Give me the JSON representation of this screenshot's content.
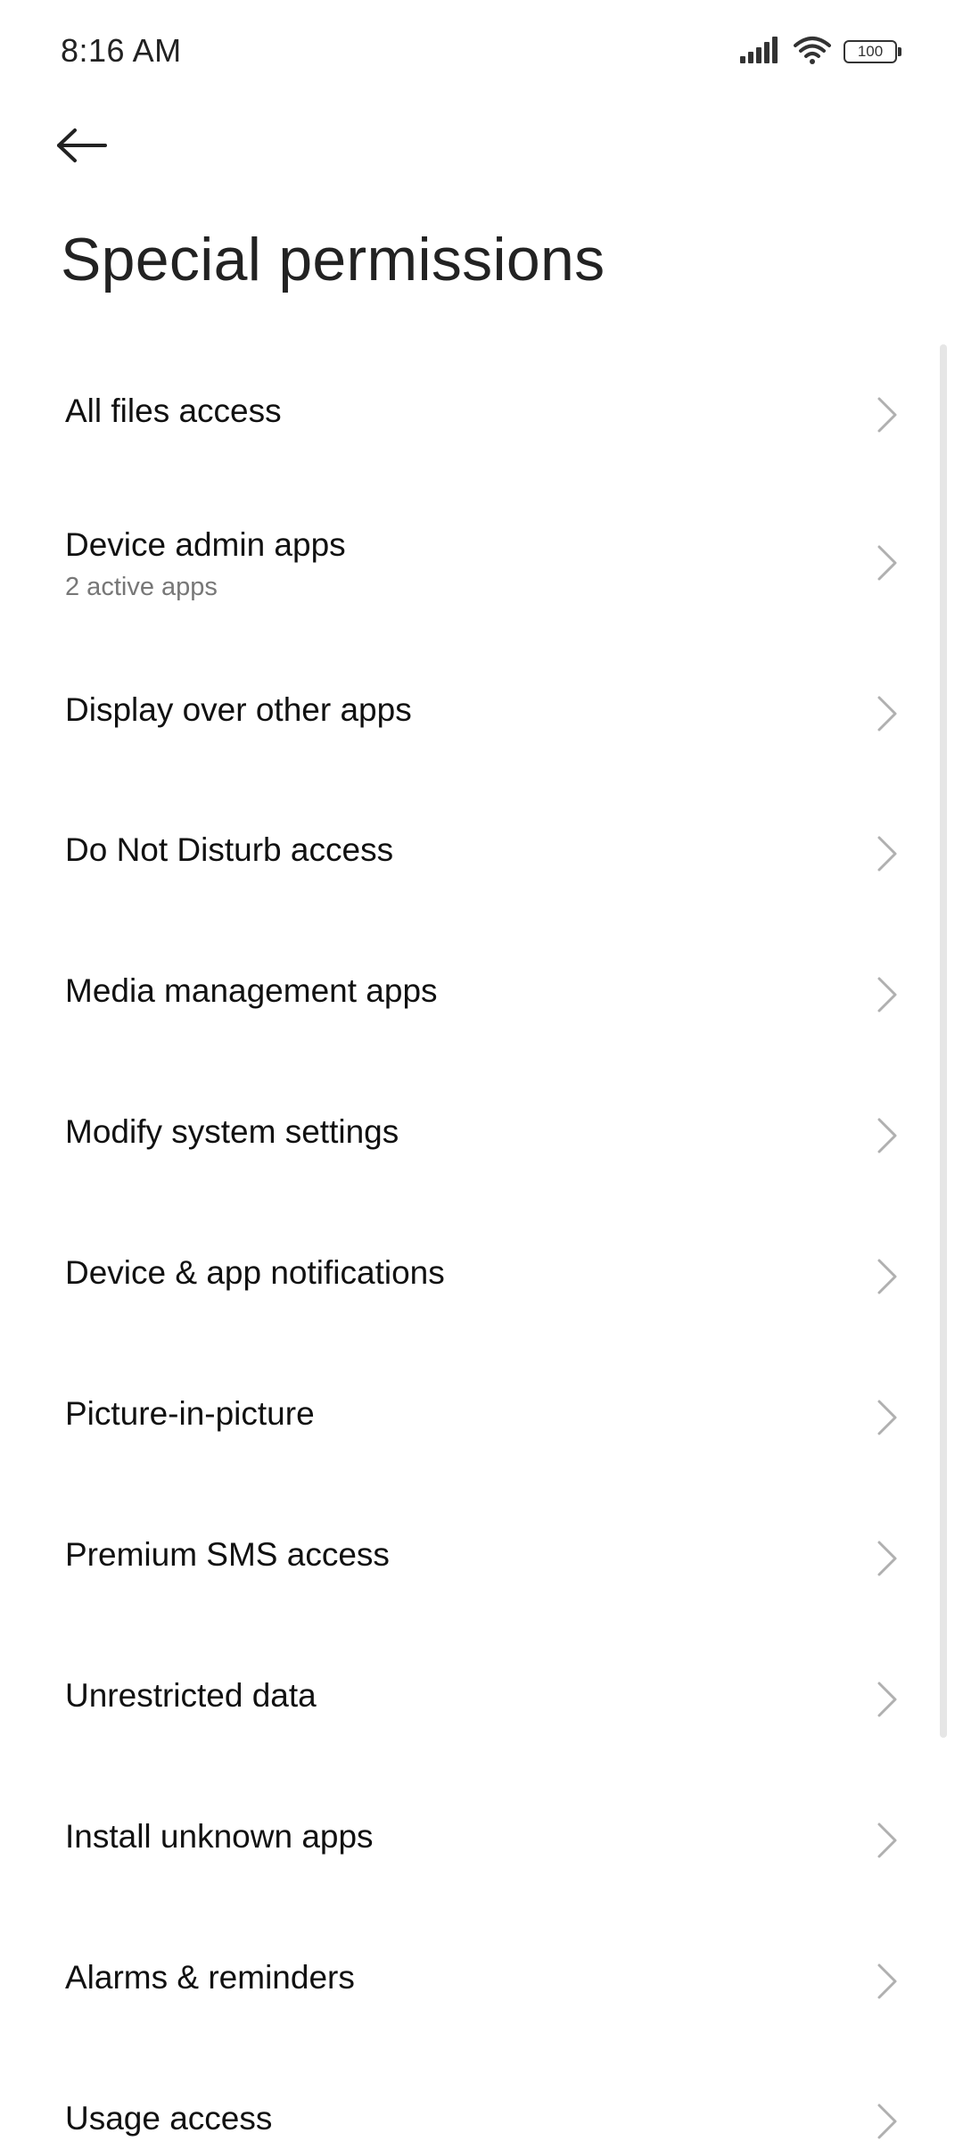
{
  "status_bar": {
    "time": "8:16 AM",
    "battery": "100",
    "icons": [
      "signal-icon",
      "wifi-icon",
      "battery-icon"
    ]
  },
  "header": {
    "back_icon": "arrow-left-icon",
    "title": "Special permissions"
  },
  "items": [
    {
      "label": "All files access"
    },
    {
      "label": "Device admin apps",
      "subtitle": "2 active apps"
    },
    {
      "label": "Display over other apps"
    },
    {
      "label": "Do Not Disturb access"
    },
    {
      "label": "Media management apps"
    },
    {
      "label": "Modify system settings"
    },
    {
      "label": "Device & app notifications"
    },
    {
      "label": "Picture-in-picture"
    },
    {
      "label": "Premium SMS access"
    },
    {
      "label": "Unrestricted data"
    },
    {
      "label": "Install unknown apps"
    },
    {
      "label": "Alarms & reminders"
    },
    {
      "label": "Usage access"
    }
  ]
}
